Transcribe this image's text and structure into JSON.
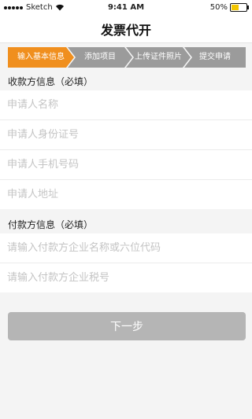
{
  "status_bar": {
    "carrier": "Sketch",
    "time": "9:41 AM",
    "battery": "50%",
    "battery_level": 0.5
  },
  "nav": {
    "title": "发票代开"
  },
  "steps": [
    {
      "label": "输入基本信息",
      "active": true
    },
    {
      "label": "添加项目",
      "active": false
    },
    {
      "label": "上传证件照片",
      "active": false
    },
    {
      "label": "提交申请",
      "active": false
    }
  ],
  "colors": {
    "step_active": "#f08f1e",
    "step_inactive": "#9b9b9b",
    "button_disabled": "#b5b5b5"
  },
  "payee": {
    "header": "收款方信息（必填）",
    "fields": [
      {
        "placeholder": "申请人名称",
        "value": ""
      },
      {
        "placeholder": "申请人身份证号",
        "value": ""
      },
      {
        "placeholder": "申请人手机号码",
        "value": ""
      },
      {
        "placeholder": "申请人地址",
        "value": ""
      }
    ]
  },
  "payer": {
    "header": "付款方信息（必填）",
    "fields": [
      {
        "placeholder": "请输入付款方企业名称或六位代码",
        "value": ""
      },
      {
        "placeholder": "请输入付款方企业税号",
        "value": ""
      }
    ]
  },
  "next_button": {
    "label": "下一步"
  }
}
